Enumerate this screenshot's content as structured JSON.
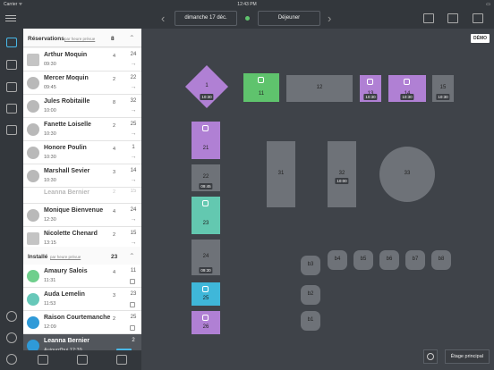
{
  "status": {
    "carrier": "Carrier ᯤ",
    "time": "12:43 PM",
    "battery": "▭"
  },
  "topbar": {
    "date": "dimanche 17 déc.",
    "service": "Déjeuner",
    "prev_arrow": "‹",
    "next_arrow": "›"
  },
  "reservations": {
    "title": "Réservations",
    "sort": "par heure prévue",
    "count": "8",
    "items": [
      {
        "name": "Arthur Moquin",
        "time": "09:30",
        "covers": "4",
        "table": "24",
        "icon": "house-icon"
      },
      {
        "name": "Mercer Moquin",
        "time": "09:45",
        "covers": "2",
        "table": "22",
        "icon": "person-icon"
      },
      {
        "name": "Jules Robitaille",
        "time": "10:00",
        "covers": "8",
        "table": "32",
        "icon": "person-icon"
      },
      {
        "name": "Fanette Loiselle",
        "time": "10:30",
        "covers": "2",
        "table": "25",
        "icon": "person-icon"
      },
      {
        "name": "Honore Poulin",
        "time": "10:30",
        "covers": "4",
        "table": "1",
        "icon": "person-icon"
      },
      {
        "name": "Marshall Sevier",
        "time": "10:30",
        "covers": "3",
        "table": "14",
        "icon": "person-icon"
      },
      {
        "name": "Leanna Bernier",
        "time": "",
        "covers": "2",
        "table": "15",
        "icon": "person-icon"
      },
      {
        "name": "Monique Bienvenue",
        "time": "12:30",
        "covers": "4",
        "table": "24",
        "icon": "person-icon"
      },
      {
        "name": "Nicolette Chenard",
        "time": "13:15",
        "covers": "2",
        "table": "15",
        "icon": "house-icon"
      }
    ]
  },
  "seated": {
    "title": "Installé",
    "sort": "par heure prévue",
    "count": "23",
    "items": [
      {
        "name": "Amaury Salois",
        "time": "11:31",
        "covers": "4",
        "table": "11"
      },
      {
        "name": "Auda Lemelin",
        "time": "11:53",
        "covers": "3",
        "table": "23"
      },
      {
        "name": "Raison Courtemanche",
        "time": "12:09",
        "covers": "2",
        "table": "25"
      },
      {
        "name": "Leanna Bernier",
        "time": "Aujourd'hui 12:39",
        "covers": "2",
        "table": "15",
        "badge": "Attente"
      }
    ]
  },
  "floor": {
    "demo_label": "DÉMO",
    "etage_label": "Étage principal",
    "tables": {
      "t1": "1",
      "t1_time": "10:30",
      "t11": "11",
      "t12": "12",
      "t13": "13",
      "t13_time": "10:30",
      "t14": "14",
      "t14_time": "10:30",
      "t15": "15",
      "t15_time": "10:30",
      "t21": "21",
      "t22": "22",
      "t22_time": "09:45",
      "t23": "23",
      "t24": "24",
      "t24_time": "09:30",
      "t25": "25",
      "t26": "26",
      "t31": "31",
      "t32": "32",
      "t32_time": "10:00",
      "t33": "33",
      "b1": "b1",
      "b2": "b2",
      "b3": "b3",
      "b4": "b4",
      "b5": "b5",
      "b6": "b6",
      "b7": "b7",
      "b8": "b8"
    }
  },
  "colors": {
    "reserved": "#b080d4",
    "seated_green": "#5fc36d",
    "seated_teal": "#63c8b0",
    "seated_cyan": "#3fb7d9",
    "free": "#6e7278",
    "accent": "#49b8e8"
  }
}
